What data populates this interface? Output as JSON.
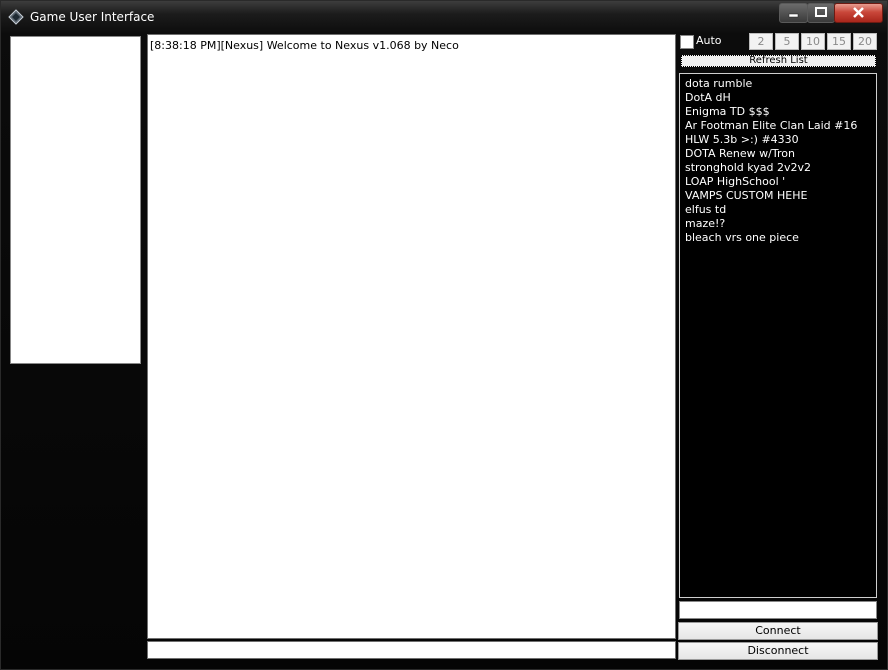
{
  "window": {
    "title": "Game User Interface"
  },
  "chat": {
    "lines": [
      "[8:38:18 PM][Nexus] Welcome to Nexus v1.068 by Neco"
    ]
  },
  "auto": {
    "label": "Auto",
    "checked": false
  },
  "intervals": [
    "2",
    "5",
    "10",
    "15",
    "20"
  ],
  "refresh_label": "Refresh List",
  "games": [
    "dota rumble",
    "DotA dH",
    "Enigma TD $$$",
    "Ar Footman Elite Clan Laid #16",
    "HLW 5.3b >:) #4330",
    "DOTA Renew w/Tron",
    "stronghold kyad 2v2v2",
    "LOAP HighSchool  '",
    "VAMPS CUSTOM HEHE",
    "elfus td",
    "maze!?",
    "bleach vrs one piece"
  ],
  "connect_label": "Connect",
  "disconnect_label": "Disconnect"
}
